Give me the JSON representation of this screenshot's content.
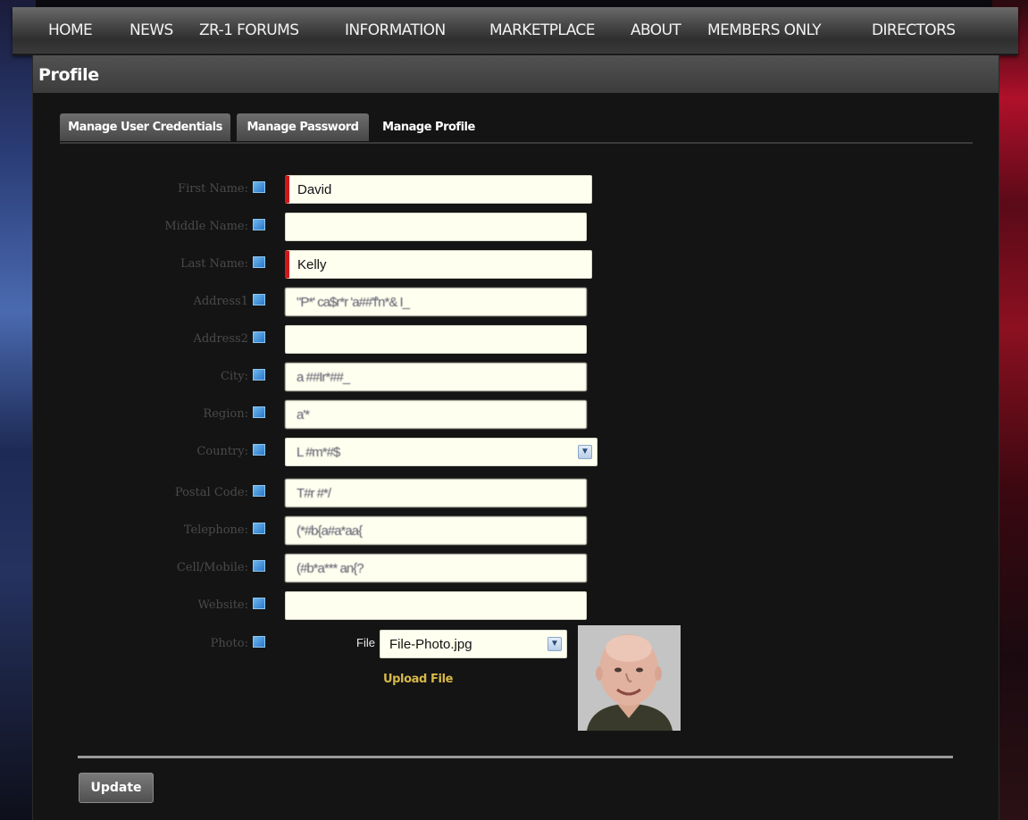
{
  "nav": {
    "items": [
      "HOME",
      "NEWS",
      "ZR-1 FORUMS",
      "INFORMATION",
      "MARKETPLACE",
      "ABOUT",
      "MEMBERS ONLY",
      "DIRECTORS"
    ]
  },
  "page": {
    "title": "Profile"
  },
  "tabs": [
    {
      "label": "Manage User Credentials",
      "active": false
    },
    {
      "label": "Manage Password",
      "active": false
    },
    {
      "label": "Manage Profile",
      "active": true
    }
  ],
  "form": {
    "fields": [
      {
        "label": "First Name:",
        "value": "David",
        "required": true
      },
      {
        "label": "Middle Name:",
        "value": "",
        "required": false
      },
      {
        "label": "Last Name:",
        "value": "Kelly",
        "required": true
      },
      {
        "label": "Address1",
        "value": "\"P*' ca$r*r 'a##'f'n*& I_",
        "required": false
      },
      {
        "label": "Address2",
        "value": "",
        "required": false
      },
      {
        "label": "City:",
        "value": "a ##Ir*##_",
        "required": false
      },
      {
        "label": "Region:",
        "value": "a'*",
        "required": false
      },
      {
        "label": "Country:",
        "value": "L #m*#$",
        "required": false
      },
      {
        "label": "Postal Code:",
        "value": "T#r #*/",
        "required": false
      },
      {
        "label": "Telephone:",
        "value": "(*#b{a#a*aa{",
        "required": false
      },
      {
        "label": "Cell/Mobile:",
        "value": "(#b*a*** an{?",
        "required": false
      },
      {
        "label": "Website:",
        "value": "",
        "required": false
      }
    ],
    "photo": {
      "label": "Photo:",
      "file_label": "File",
      "file_value": "File-Photo.jpg",
      "upload_label": "Upload File"
    }
  },
  "actions": {
    "update_label": "Update"
  },
  "icons": {
    "help": "help-icon",
    "dropdown": "chevron-down-icon"
  },
  "colors": {
    "required_marker": "#d01818",
    "input_bg": "#fffff0",
    "upload_link": "#d6b84a"
  }
}
